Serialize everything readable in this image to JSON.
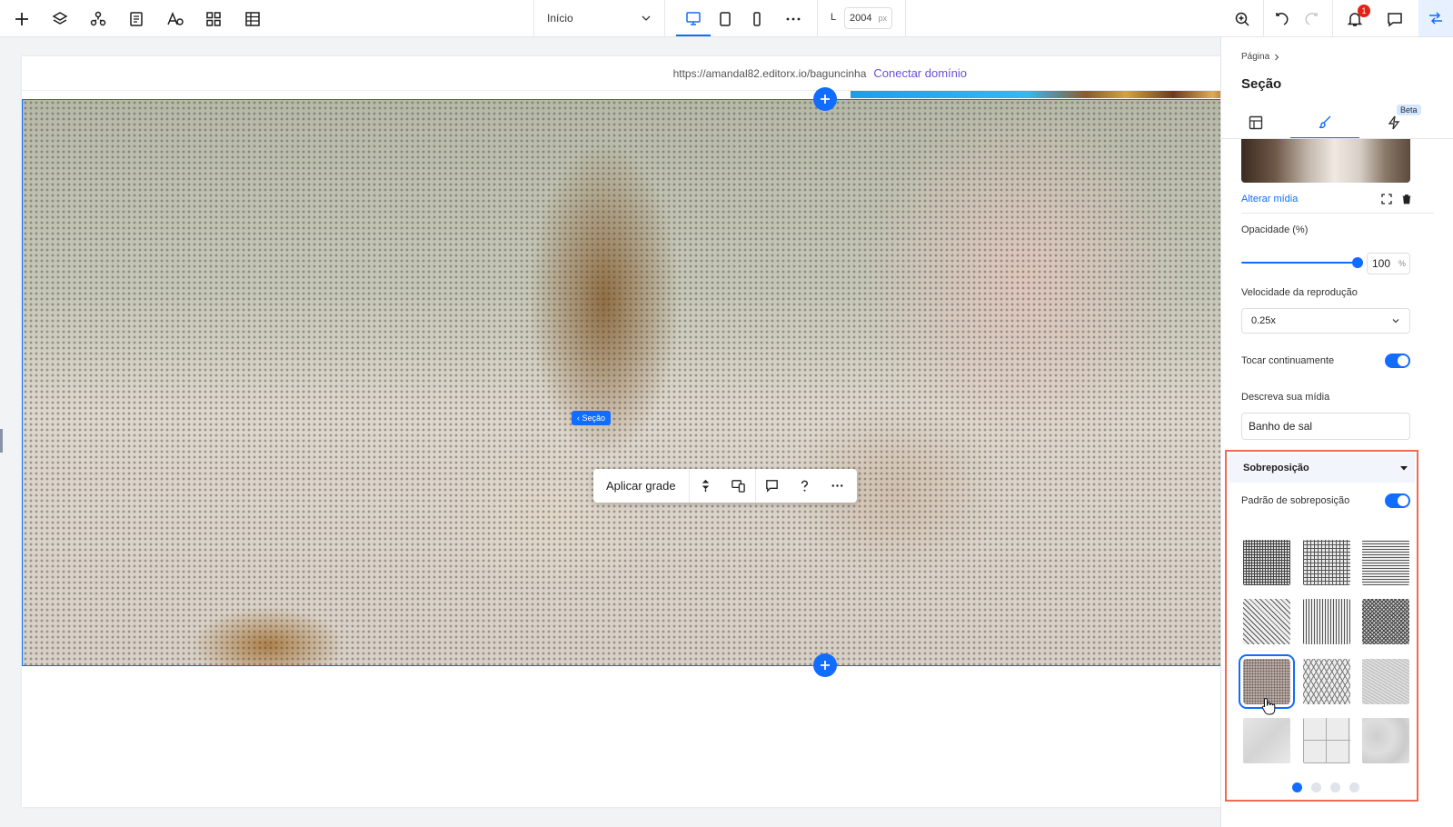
{
  "topbar": {
    "left_icons": [
      "add-icon",
      "layers-icon",
      "components-icon",
      "pages-icon",
      "fonts-icon",
      "apps-icon",
      "table-icon"
    ],
    "page_selector": {
      "value": "Início"
    },
    "devices": [
      "desktop-icon",
      "tablet-icon",
      "mobile-icon",
      "more-icon"
    ],
    "width": {
      "label": "L",
      "value": "2004",
      "unit": "px"
    },
    "notifications_count": "1"
  },
  "canvas": {
    "url": "https://amandal82.editorx.io/baguncinha",
    "connect_domain": "Conectar domínio"
  },
  "float_toolbar": {
    "apply_grid": "Aplicar grade",
    "section_tag": "‹ Seção"
  },
  "panel": {
    "breadcrumb": "Página",
    "title": "Seção",
    "beta_badge": "Beta",
    "change_media": "Alterar mídia",
    "opacity_label": "Opacidade (%)",
    "opacity_value": "100",
    "opacity_unit": "%",
    "opacity_level": 1.0,
    "speed_label": "Velocidade da reprodução",
    "speed_value": "0.25x",
    "loop_label": "Tocar continuamente",
    "loop_on": true,
    "describe_label": "Descreva sua mídia",
    "describe_value": "Banho de sal",
    "overlay_title": "Sobreposição",
    "overlay_pattern_label": "Padrão de sobreposição",
    "overlay_pattern_on": true,
    "patterns": [
      "grid-dense",
      "grid",
      "horizontal-lines",
      "diagonal-lines",
      "vertical-lines",
      "crosshatch",
      "dots",
      "chevron",
      "noise",
      "paper",
      "tile",
      "concrete"
    ],
    "selected_pattern": "dots",
    "pager": {
      "pages": 4,
      "current": 1
    }
  },
  "colors": {
    "accent": "#116dff",
    "link_purple": "#6a4fd8",
    "highlight_border": "#ef6b54",
    "badge_red": "#e62214"
  }
}
